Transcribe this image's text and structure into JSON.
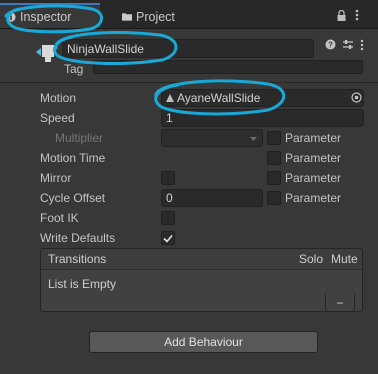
{
  "tabs": [
    {
      "label": "Inspector",
      "icon": "info-icon"
    },
    {
      "label": "Project",
      "icon": "folder-icon"
    }
  ],
  "header": {
    "name": "NinjaWallSlide",
    "tag_label": "Tag"
  },
  "fields": {
    "motion_label": "Motion",
    "motion_value": "AyaneWallSlide",
    "speed_label": "Speed",
    "speed_value": "1",
    "multiplier_label": "Multiplier",
    "motion_time_label": "Motion Time",
    "mirror_label": "Mirror",
    "cycle_offset_label": "Cycle Offset",
    "cycle_offset_value": "0",
    "foot_ik_label": "Foot IK",
    "write_defaults_label": "Write Defaults",
    "write_defaults_checked": true,
    "parameter_label": "Parameter"
  },
  "transitions": {
    "title": "Transitions",
    "solo": "Solo",
    "mute": "Mute",
    "empty": "List is Empty",
    "remove": "−"
  },
  "add_behaviour": "Add Behaviour",
  "colors": {
    "annotation": "#1aa8d6",
    "accent": "#3a79bb"
  }
}
